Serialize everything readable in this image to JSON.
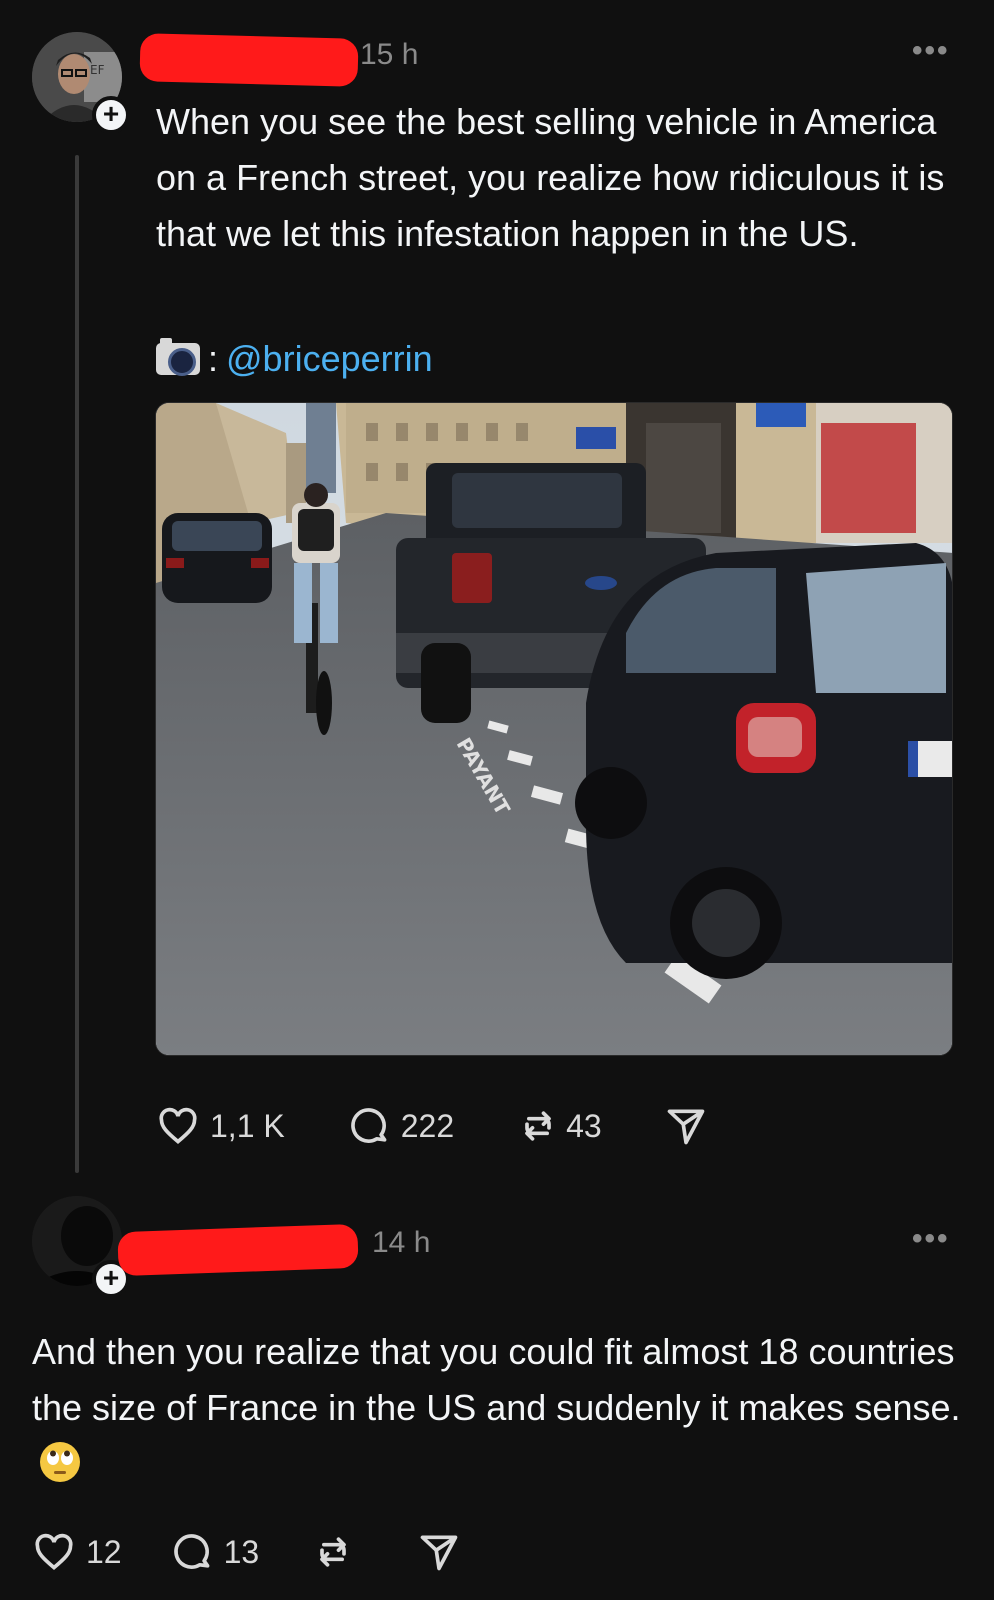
{
  "post": {
    "time": "15 h",
    "text": "When you see the best selling vehicle in America on a French street, you realize how ridiculous it is that we let this infestation happen in the US.",
    "credit_separator": ":",
    "credit_handle": "@briceperrin",
    "image_alt": "Paris street with a cyclist in a bike lane, a large black pickup truck parked next to a small black smart car",
    "street_marking": "PAYANT",
    "likes": "1,1 K",
    "replies": "222",
    "reposts": "43"
  },
  "reply": {
    "time": "14 h",
    "text": "And then you realize that you could fit almost 18 countries the size of France in the US and suddenly it makes sense.",
    "likes": "12",
    "replies": "13"
  },
  "icons": [
    "plus-icon",
    "more-icon",
    "camera-icon",
    "heart-icon",
    "comment-icon",
    "repost-icon",
    "share-icon",
    "eye-roll-emoji-icon"
  ],
  "colors": {
    "background": "#101010",
    "text": "#f3f5f7",
    "muted": "#8a8a8a",
    "link": "#4cb0f0",
    "redaction": "#ff1a1a"
  }
}
